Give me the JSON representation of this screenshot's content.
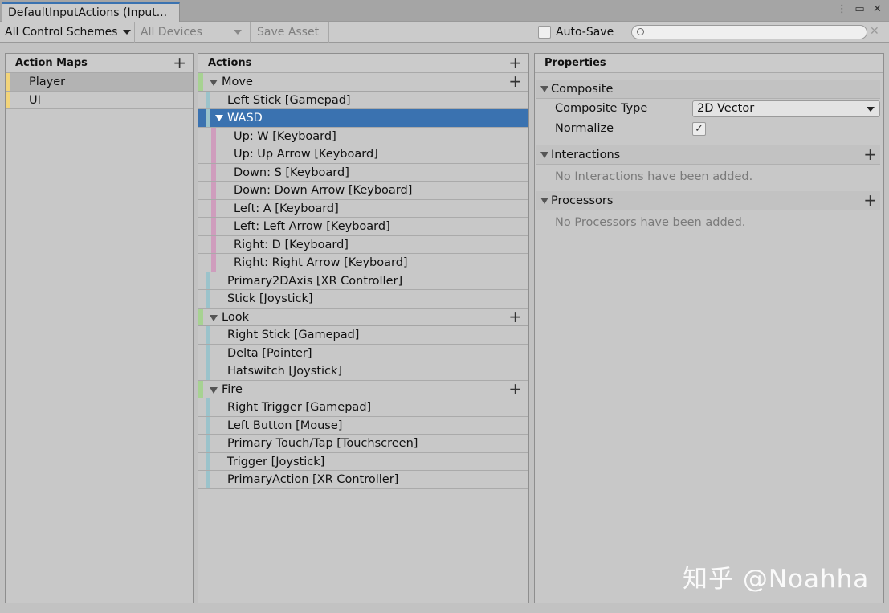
{
  "window": {
    "tab_title": "DefaultInputActions (Input...",
    "icons": [
      "more-vert-icon",
      "maximize-icon",
      "close-icon"
    ]
  },
  "toolbar": {
    "control_schemes": "All Control Schemes",
    "devices": "All Devices",
    "save_asset": "Save Asset",
    "auto_save_label": "Auto-Save",
    "auto_save_checked": false,
    "search_value": ""
  },
  "action_maps": {
    "header": "Action Maps",
    "items": [
      {
        "label": "Player",
        "selected": true
      },
      {
        "label": "UI",
        "selected": false
      }
    ]
  },
  "actions": {
    "header": "Actions",
    "move": {
      "label": "Move",
      "bindings": [
        "Left Stick [Gamepad]"
      ],
      "composite": {
        "label": "WASD",
        "parts": [
          "Up: W [Keyboard]",
          "Up: Up Arrow [Keyboard]",
          "Down: S [Keyboard]",
          "Down: Down Arrow [Keyboard]",
          "Left: A [Keyboard]",
          "Left: Left Arrow [Keyboard]",
          "Right: D [Keyboard]",
          "Right: Right Arrow [Keyboard]"
        ]
      },
      "more_bindings": [
        "Primary2DAxis [XR Controller]",
        "Stick [Joystick]"
      ]
    },
    "look": {
      "label": "Look",
      "bindings": [
        "Right Stick [Gamepad]",
        "Delta [Pointer]",
        "Hatswitch [Joystick]"
      ]
    },
    "fire": {
      "label": "Fire",
      "bindings": [
        "Right Trigger [Gamepad]",
        "Left Button [Mouse]",
        "Primary Touch/Tap [Touchscreen]",
        "Trigger [Joystick]",
        "PrimaryAction [XR Controller]"
      ]
    }
  },
  "properties": {
    "header": "Properties",
    "composite_section": "Composite",
    "composite_type_label": "Composite Type",
    "composite_type_value": "2D Vector",
    "normalize_label": "Normalize",
    "normalize_checked": true,
    "interactions_section": "Interactions",
    "interactions_empty": "No Interactions have been added.",
    "processors_section": "Processors",
    "processors_empty": "No Processors have been added."
  },
  "watermark": "知乎 @Noahha",
  "colors": {
    "selection": "#3a72b0",
    "map_strip": "#f2d47a",
    "action_strip": "#a7d292",
    "binding_strip": "#9bc3cb",
    "part_strip": "#cf9dbd"
  }
}
